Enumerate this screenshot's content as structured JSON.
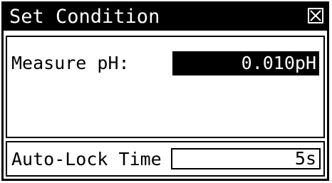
{
  "dialog": {
    "title": "Set Condition",
    "close_icon": "close-x-box-icon"
  },
  "measure": {
    "label": "Measure pH:",
    "value": "0.010pH"
  },
  "auto_lock": {
    "label": "Auto-Lock Time",
    "value": "5s"
  },
  "colors": {
    "background": "#ffffff",
    "foreground": "#000000",
    "selected_bg": "#000000",
    "selected_fg": "#ffffff"
  }
}
